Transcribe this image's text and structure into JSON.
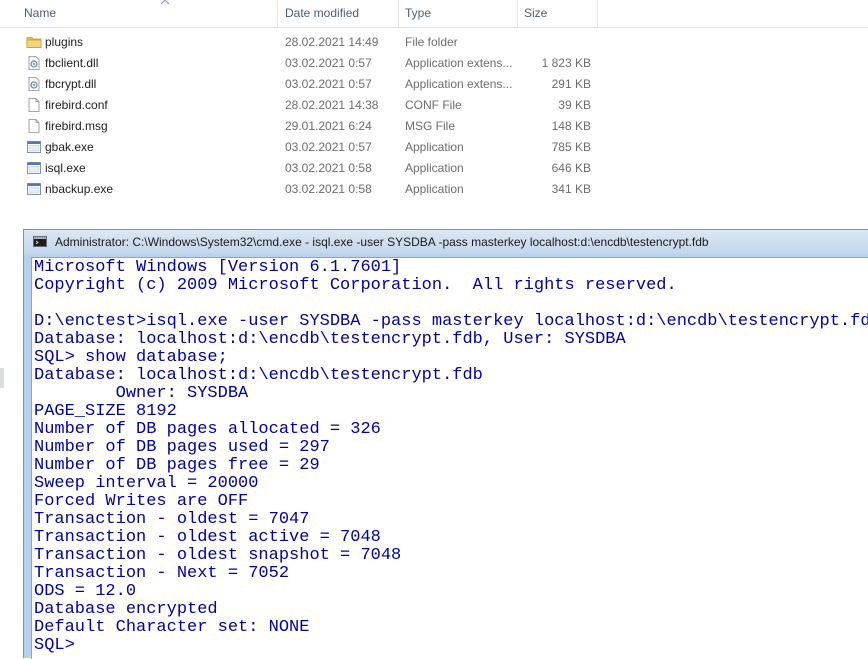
{
  "explorer": {
    "columns": {
      "name": "Name",
      "date_modified": "Date modified",
      "type": "Type",
      "size": "Size"
    },
    "files": [
      {
        "icon": "folder-icon",
        "name": "plugins",
        "date": "28.02.2021 14:49",
        "type": "File folder",
        "size": ""
      },
      {
        "icon": "dll-icon",
        "name": "fbclient.dll",
        "date": "03.02.2021 0:57",
        "type": "Application extens...",
        "size": "1 823 KB"
      },
      {
        "icon": "dll-icon",
        "name": "fbcrypt.dll",
        "date": "03.02.2021 0:57",
        "type": "Application extens...",
        "size": "291 KB"
      },
      {
        "icon": "file-icon",
        "name": "firebird.conf",
        "date": "28.02.2021 14:38",
        "type": "CONF File",
        "size": "39 KB"
      },
      {
        "icon": "file-icon",
        "name": "firebird.msg",
        "date": "29.01.2021 6:24",
        "type": "MSG File",
        "size": "148 KB"
      },
      {
        "icon": "exe-icon",
        "name": "gbak.exe",
        "date": "03.02.2021 0:57",
        "type": "Application",
        "size": "785 KB"
      },
      {
        "icon": "exe-icon",
        "name": "isql.exe",
        "date": "03.02.2021 0:58",
        "type": "Application",
        "size": "646 KB"
      },
      {
        "icon": "exe-icon",
        "name": "nbackup.exe",
        "date": "03.02.2021 0:58",
        "type": "Application",
        "size": "341 KB"
      }
    ]
  },
  "cmd": {
    "title": "Administrator: C:\\Windows\\System32\\cmd.exe - isql.exe  -user SYSDBA -pass masterkey localhost:d:\\encdb\\testencrypt.fdb",
    "text_color": "#0000a8",
    "lines": [
      "Microsoft Windows [Version 6.1.7601]",
      "Copyright (c) 2009 Microsoft Corporation.  All rights reserved.",
      "",
      "D:\\enctest>isql.exe -user SYSDBA -pass masterkey localhost:d:\\encdb\\testencrypt.fdb",
      "Database: localhost:d:\\encdb\\testencrypt.fdb, User: SYSDBA",
      "SQL> show database;",
      "Database: localhost:d:\\encdb\\testencrypt.fdb",
      "        Owner: SYSDBA",
      "PAGE_SIZE 8192",
      "Number of DB pages allocated = 326",
      "Number of DB pages used = 297",
      "Number of DB pages free = 29",
      "Sweep interval = 20000",
      "Forced Writes are OFF",
      "Transaction - oldest = 7047",
      "Transaction - oldest active = 7048",
      "Transaction - oldest snapshot = 7048",
      "Transaction - Next = 7052",
      "ODS = 12.0",
      "Database encrypted",
      "Default Character set: NONE",
      "SQL>"
    ]
  }
}
